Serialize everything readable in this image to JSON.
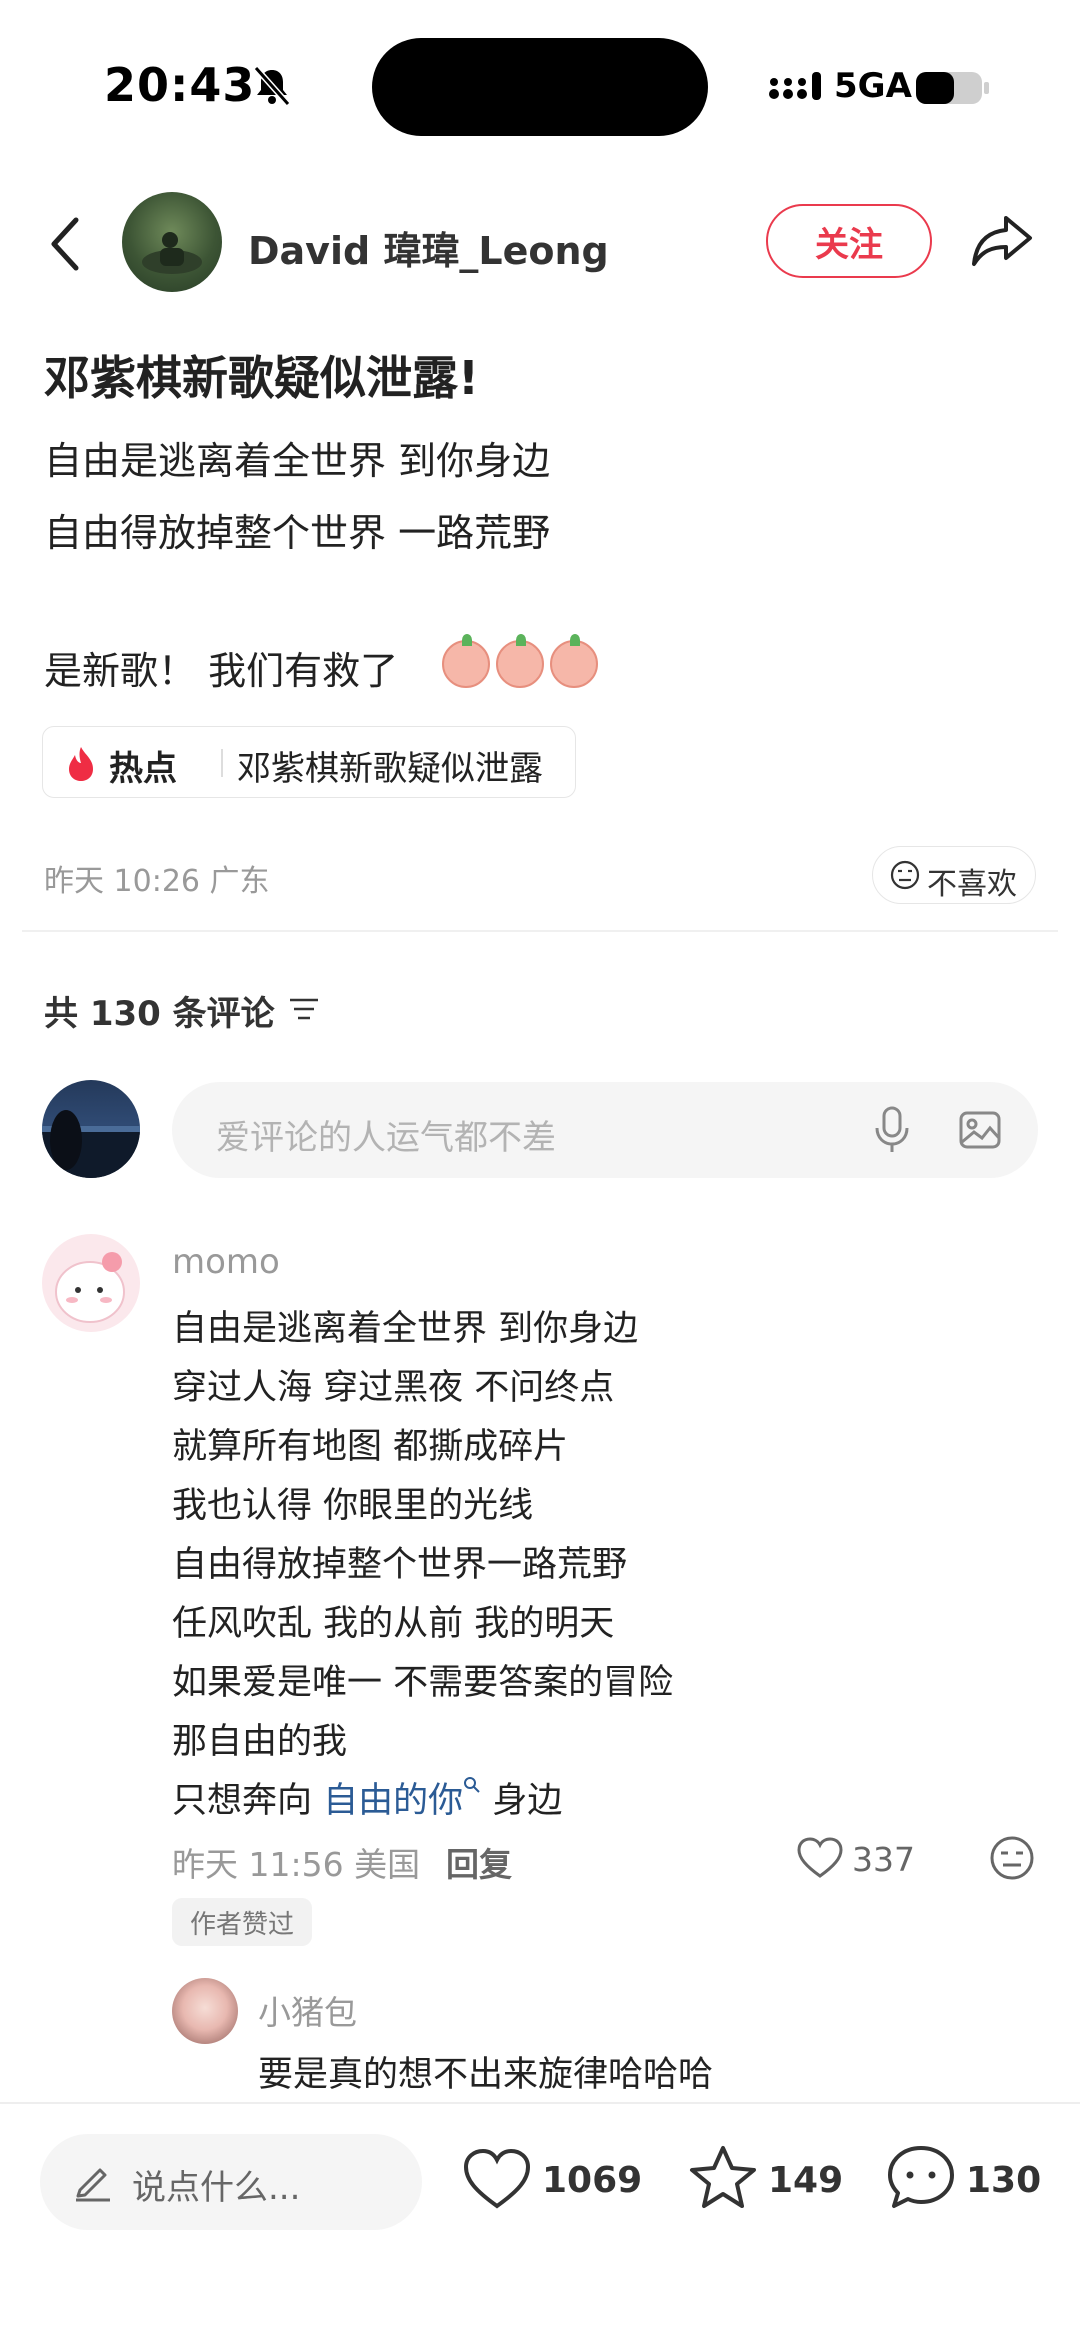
{
  "status_bar": {
    "time": "20:43",
    "network": "5GA"
  },
  "header": {
    "author_name": "David 瑋瑋_Leong",
    "follow_label": "关注"
  },
  "post": {
    "title": "邓紫棋新歌疑似泄露!",
    "lines": [
      "自由是逃离着全世界 到你身边",
      "自由得放掉整个世界 一路荒野"
    ],
    "tail_text": "是新歌！ 我们有救了",
    "hot_label": "热点",
    "hot_text": "邓紫棋新歌疑似泄露",
    "meta": "昨天 10:26 广东",
    "dislike_label": "不喜欢"
  },
  "comments_header": {
    "count_text": "共 130 条评论"
  },
  "comment_input": {
    "placeholder": "爱评论的人运气都不差"
  },
  "comment": {
    "user": "momo",
    "lines": [
      "自由是逃离着全世界 到你身边",
      "穿过人海 穿过黑夜 不问终点",
      "就算所有地图 都撕成碎片",
      "我也认得 你眼里的光线",
      "自由得放掉整个世界一路荒野",
      "任风吹乱 我的从前 我的明天",
      "如果爱是唯一 不需要答案的冒险",
      "那自由的我"
    ],
    "last_prefix": "只想奔向",
    "last_link": "自由的你",
    "last_suffix": "身边",
    "meta": "昨天 11:56 美国",
    "reply_label": "回复",
    "likes": "337",
    "author_liked": "作者赞过",
    "reply": {
      "user": "小猪包",
      "text": "要是真的想不出来旋律哈哈哈"
    }
  },
  "bottom_bar": {
    "say_placeholder": "说点什么...",
    "likes": "1069",
    "stars": "149",
    "comments": "130"
  }
}
